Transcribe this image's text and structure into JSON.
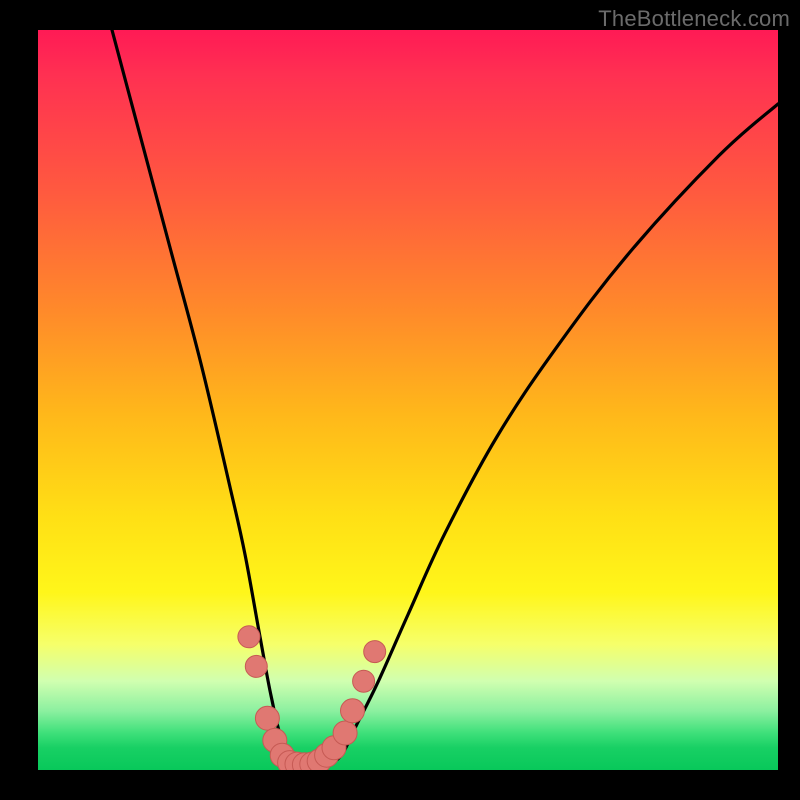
{
  "watermark": "TheBottleneck.com",
  "chart_data": {
    "type": "line",
    "title": "",
    "xlabel": "",
    "ylabel": "",
    "xlim": [
      0,
      100
    ],
    "ylim": [
      0,
      100
    ],
    "series": [
      {
        "name": "bottleneck-curve",
        "x": [
          10,
          14,
          18,
          22,
          26,
          28,
          30,
          31.5,
          33,
          35,
          37,
          39,
          41,
          43,
          46,
          50,
          55,
          62,
          70,
          80,
          92,
          100
        ],
        "y": [
          100,
          85,
          70,
          55,
          38,
          29,
          18,
          10,
          4,
          1,
          0.5,
          0.8,
          2,
          6,
          12,
          21,
          32,
          45,
          57,
          70,
          83,
          90
        ]
      },
      {
        "name": "optimal-band-markers",
        "x": [
          28.5,
          29.5,
          31,
          32,
          33,
          34,
          35,
          36,
          37,
          38,
          39,
          40,
          41.5,
          42.5,
          44,
          45.5
        ],
        "y": [
          18,
          14,
          7,
          4,
          2,
          1,
          0.8,
          0.7,
          0.8,
          1.2,
          2,
          3,
          5,
          8,
          12,
          16
        ]
      }
    ],
    "colors": {
      "curve": "#000000",
      "markers_fill": "#e07872",
      "markers_stroke": "#c65a54",
      "gradient_top": "#ff1a55",
      "gradient_mid": "#ffe015",
      "gradient_bottom": "#08c85a"
    },
    "background_meaning": "red = high bottleneck, green = balanced"
  }
}
